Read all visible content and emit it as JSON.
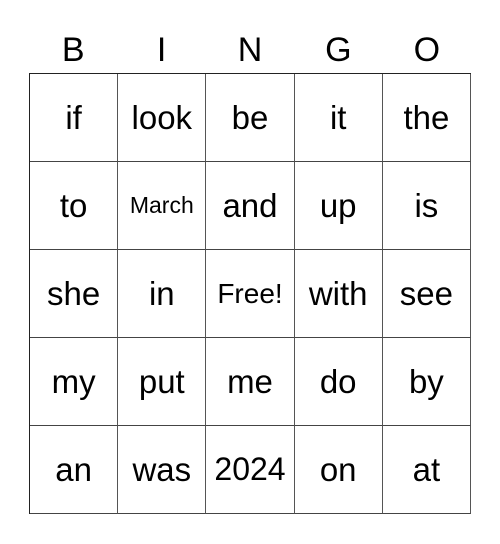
{
  "card": {
    "header": [
      "B",
      "I",
      "N",
      "G",
      "O"
    ],
    "rows": [
      [
        "if",
        "look",
        "be",
        "it",
        "the"
      ],
      [
        "to",
        "March",
        "and",
        "up",
        "is"
      ],
      [
        "she",
        "in",
        "Free!",
        "with",
        "see"
      ],
      [
        "my",
        "put",
        "me",
        "do",
        "by"
      ],
      [
        "an",
        "was",
        "2024",
        "on",
        "at"
      ]
    ]
  }
}
